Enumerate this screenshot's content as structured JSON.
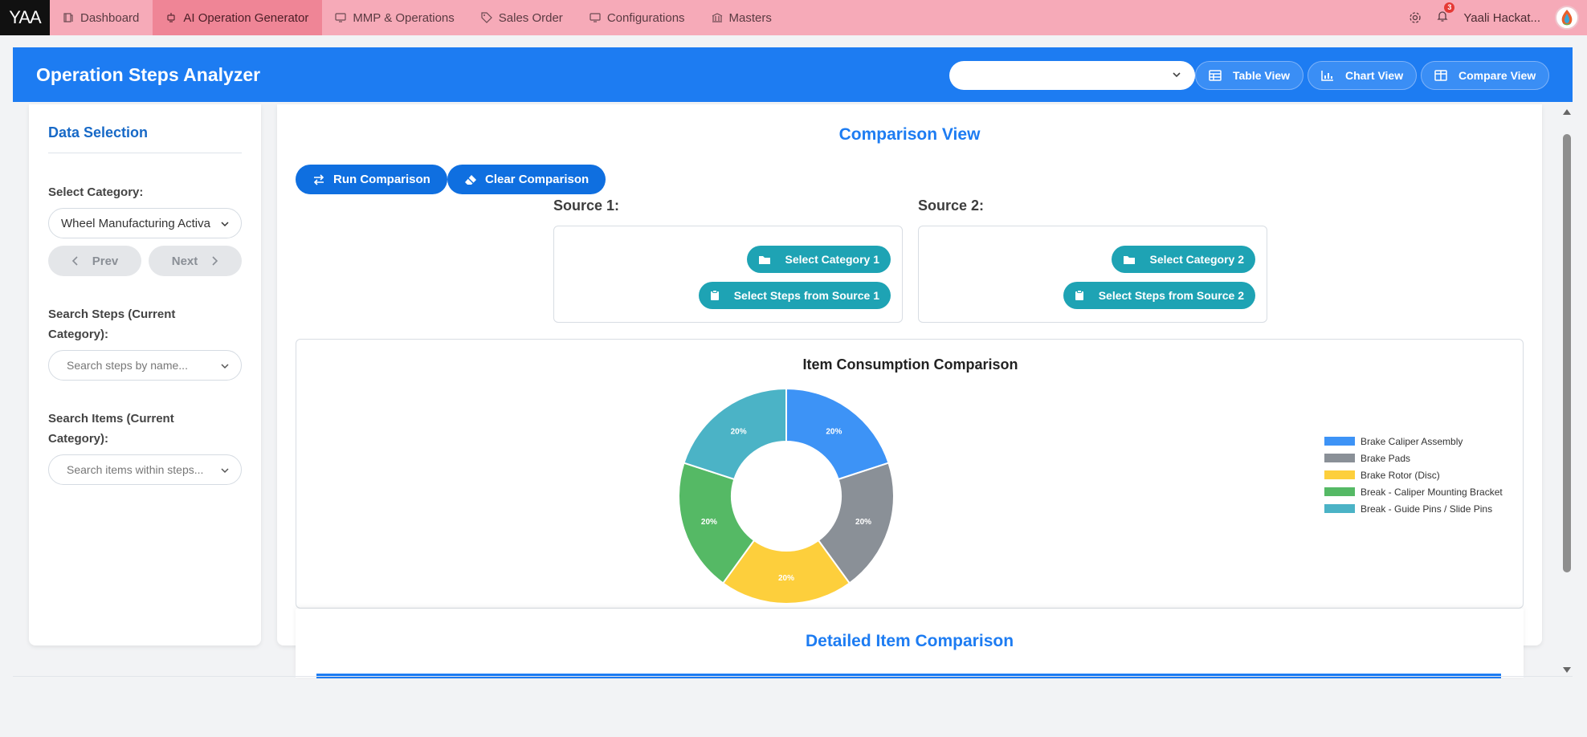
{
  "nav": {
    "logo": "YAA",
    "items": [
      {
        "label": "Dashboard"
      },
      {
        "label": "AI Operation Generator"
      },
      {
        "label": "MMP & Operations"
      },
      {
        "label": "Sales Order"
      },
      {
        "label": "Configurations"
      },
      {
        "label": "Masters"
      }
    ],
    "notification_count": "3",
    "user_name": "Yaali Hackat..."
  },
  "header": {
    "title": "Operation Steps Analyzer",
    "select_value": "",
    "table_view": "Table View",
    "chart_view": "Chart View",
    "compare_view": "Compare View"
  },
  "left": {
    "title": "Data Selection",
    "category_label": "Select Category:",
    "category_value": "Wheel Manufacturing Activa",
    "prev": "Prev",
    "next": "Next",
    "steps_label": "Search Steps (Current Category):",
    "steps_placeholder": "Search steps by name...",
    "items_label": "Search Items (Current Category):",
    "items_placeholder": "Search items within steps..."
  },
  "main": {
    "title": "Comparison View",
    "run_label": "Run Comparison",
    "clear_label": "Clear Comparison",
    "source1_label": "Source 1:",
    "source2_label": "Source 2:",
    "select_cat1": "Select Category 1",
    "select_steps1": "Select Steps from Source 1",
    "select_cat2": "Select Category 2",
    "select_steps2": "Select Steps from Source 2",
    "detail_title": "Detailed Item Comparison"
  },
  "colors": {
    "primary": "#1d7cf2",
    "teal": "#1ea3b4",
    "nav_bg": "#f6aab8",
    "nav_active": "#ef8596"
  },
  "chart_data": {
    "type": "pie",
    "title": "Item Consumption Comparison",
    "donut": true,
    "legend_position": "right",
    "categories": [
      "Brake Caliper Assembly",
      "Brake Pads",
      "Brake Rotor (Disc)",
      "Break - Caliper Mounting Bracket",
      "Break - Guide Pins / Slide Pins"
    ],
    "values": [
      20,
      20,
      20,
      20,
      20
    ],
    "labels": [
      "20%",
      "20%",
      "20%",
      "20%",
      "20%"
    ],
    "colors": [
      "#3d93f6",
      "#8a9097",
      "#fdcf3c",
      "#55b965",
      "#4bb3c6"
    ]
  }
}
